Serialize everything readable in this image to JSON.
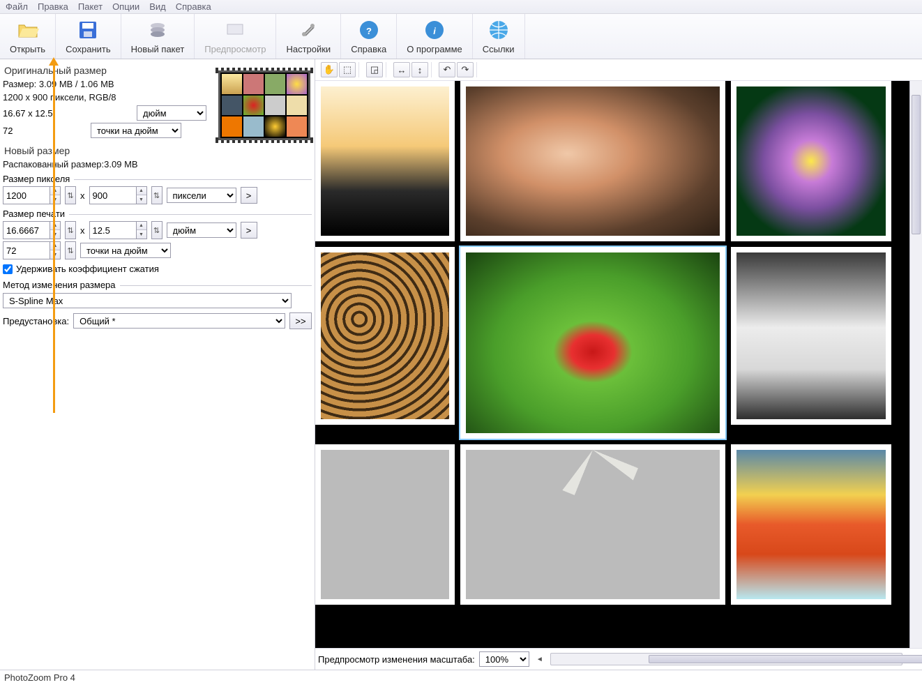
{
  "menu": {
    "file": "Файл",
    "edit": "Правка",
    "batch": "Пакет",
    "options": "Опции",
    "view": "Вид",
    "help": "Справка"
  },
  "toolbar": {
    "open": "Открыть",
    "save": "Сохранить",
    "newBatch": "Новый пакет",
    "preview": "Предпросмотр",
    "settings": "Настройки",
    "help": "Справка",
    "about": "О программе",
    "links": "Ссылки"
  },
  "orig": {
    "title": "Оригинальный размер",
    "size": "Размер: 3.09 MB / 1.06 MB",
    "pixels": "1200 x 900 пиксели, RGB/8",
    "physical": "16.67 x 12.5",
    "unit": "дюйм",
    "dpi": "72",
    "dpiUnit": "точки на дюйм"
  },
  "newSize": {
    "title": "Новый размер",
    "unpacked": "Распакованный размер:3.09 MB",
    "pixelSize": "Размер пикселя",
    "width": "1200",
    "height": "900",
    "unit": "пиксели",
    "x": "x",
    "printSize": "Размер печати",
    "pw": "16.6667",
    "ph": "12.5",
    "punit": "дюйм",
    "dpi": "72",
    "dpiUnit": "точки на дюйм",
    "keepRatio": "Удерживать коэффициент сжатия"
  },
  "method": {
    "title": "Метод изменения размера",
    "value": "S-Spline Max",
    "presetLabel": "Предустановка:",
    "presetValue": "Общий *",
    "more": ">>"
  },
  "previewBar": {
    "label": "Предпросмотр изменения масштаба:",
    "zoom": "100%"
  },
  "status": "PhotoZoom Pro 4",
  "arrows": {
    "go": ">"
  }
}
